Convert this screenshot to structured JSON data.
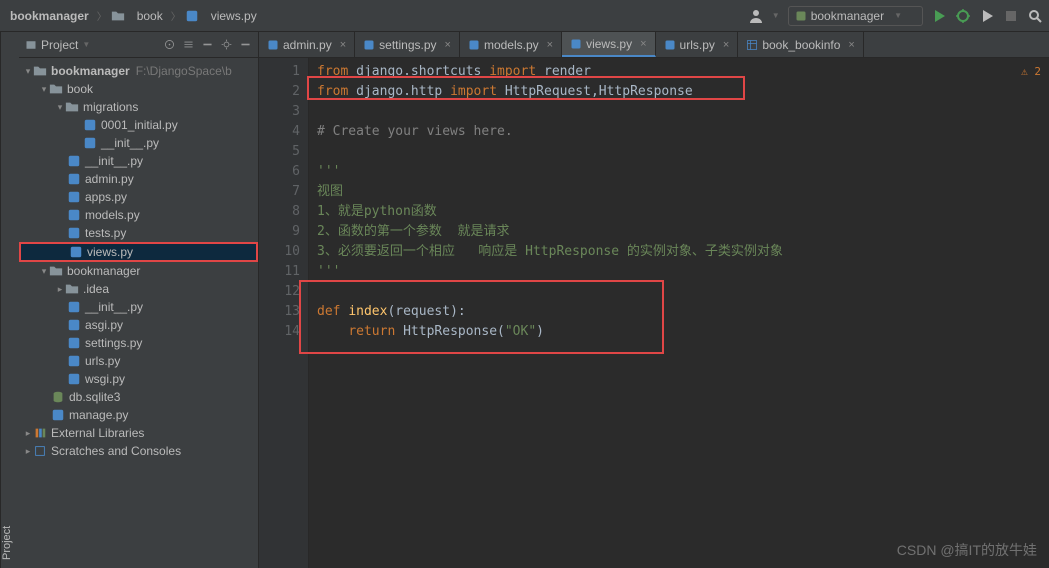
{
  "breadcrumbs": {
    "root": "bookmanager",
    "mid": "book",
    "leaf": "views.py"
  },
  "run_config": "bookmanager",
  "sidebar": {
    "title": "Project"
  },
  "tree": {
    "root": "bookmanager",
    "root_hint": "F:\\DjangoSpace\\b",
    "book": "book",
    "migrations": "migrations",
    "mig_initial": "0001_initial.py",
    "mig_init": "__init__.py",
    "book_init": "__init__.py",
    "admin": "admin.py",
    "apps": "apps.py",
    "models": "models.py",
    "tests": "tests.py",
    "views": "views.py",
    "bm_dir": "bookmanager",
    "idea": ".idea",
    "bm_init": "__init__.py",
    "asgi": "asgi.py",
    "settings": "settings.py",
    "urls": "urls.py",
    "wsgi": "wsgi.py",
    "db": "db.sqlite3",
    "manage": "manage.py",
    "ext": "External Libraries",
    "scratch": "Scratches and Consoles"
  },
  "tabs": [
    {
      "label": "admin.py"
    },
    {
      "label": "settings.py"
    },
    {
      "label": "models.py"
    },
    {
      "label": "views.py"
    },
    {
      "label": "urls.py"
    },
    {
      "label": "book_bookinfo"
    }
  ],
  "gutter": [
    "1",
    "2",
    "3",
    "4",
    "5",
    "6",
    "7",
    "8",
    "9",
    "10",
    "11",
    "12",
    "13",
    "14"
  ],
  "code": {
    "l1_from": "from",
    "l1_mod": "django.shortcuts",
    "l1_imp": "import",
    "l1_name": "render",
    "l2_from": "from",
    "l2_mod": "django.http",
    "l2_imp": "import",
    "l2_names": "HttpRequest,HttpResponse",
    "l4": "# Create your views here.",
    "l6": "'''",
    "l7": "视图",
    "l8": "1、就是python函数",
    "l9": "2、函数的第一个参数  就是请求",
    "l10": "3、必须要返回一个相应   响应是 HttpResponse 的实例对象、子类实例对象",
    "l11": "'''",
    "l13_def": "def",
    "l13_fn": "index",
    "l13_param": "(request):",
    "l14_ret": "return",
    "l14_call": "HttpResponse(",
    "l14_str": "\"OK\"",
    "l14_end": ")"
  },
  "warn": "⚠ 2",
  "watermark": "CSDN @搞IT的放牛娃"
}
